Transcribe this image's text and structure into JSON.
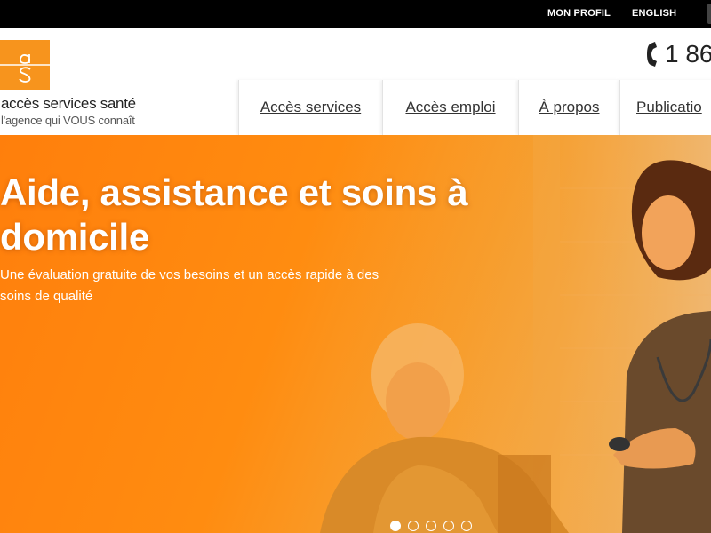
{
  "topbar": {
    "profile_link": "MON PROFIL",
    "language_link": "ENGLISH"
  },
  "brand": {
    "logo_letters": "as",
    "name": "accès services santé",
    "tagline": "l'agence qui VOUS connaît",
    "color": "#f7941d"
  },
  "contact": {
    "phone_icon": "phone-icon",
    "phone_partial": "1 86"
  },
  "nav": {
    "items": [
      {
        "label": "Accès services"
      },
      {
        "label": "Accès emploi"
      },
      {
        "label": "À propos"
      },
      {
        "label": "Publicatio"
      }
    ]
  },
  "hero": {
    "title": "Aide, assistance et soins à domicile",
    "subtitle": "Une évaluation gratuite de vos besoins et un accès rapide à des soins de qualité",
    "overlay_color": "#ff8a10"
  },
  "slider": {
    "total_slides": 5,
    "active_slide": 1
  }
}
